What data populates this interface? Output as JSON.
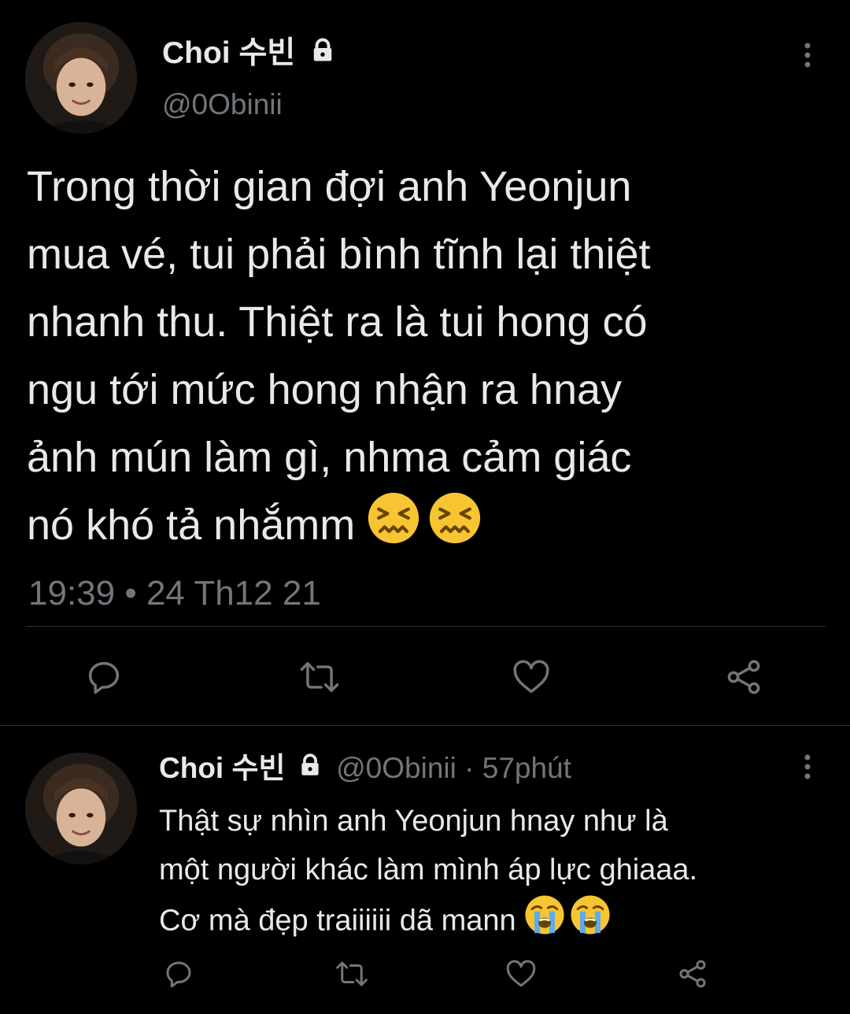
{
  "main_tweet": {
    "display_name": "Choi 수빈",
    "handle": "@0Obinii",
    "text": "Trong thời gian đợi anh Yeonjun\nmua vé, tui phải bình tĩnh lại thiệt\nnhanh thu. Thiệt ra là tui hong có\nngu tới mức hong nhận ra hnay\nảnh mún làm gì, nhma cảm giác\nnó khó tả nhắmm",
    "emoji": [
      "confounded-face",
      "confounded-face"
    ],
    "timestamp": "19:39 • 24 Th12 21"
  },
  "reply_tweet": {
    "display_name": "Choi 수빈",
    "handle_time": "@0Obinii · 57phút",
    "text": "Thật sự nhìn anh Yeonjun hnay như là\nmột người khác làm mình áp lực ghiaaa.\nCơ mà đẹp traiiiiii dã mann",
    "emoji": [
      "loudly-crying-face",
      "loudly-crying-face"
    ]
  },
  "icons": {
    "lock": "lock-icon",
    "more": "more-options-icon",
    "reply": "reply-icon",
    "retweet": "retweet-icon",
    "like": "like-icon",
    "share": "share-icon"
  },
  "colors": {
    "background": "#000000",
    "text": "#e7e9ea",
    "secondary": "#71767b",
    "divider": "#2f3336",
    "emoji_yellow": "#f7c531"
  }
}
